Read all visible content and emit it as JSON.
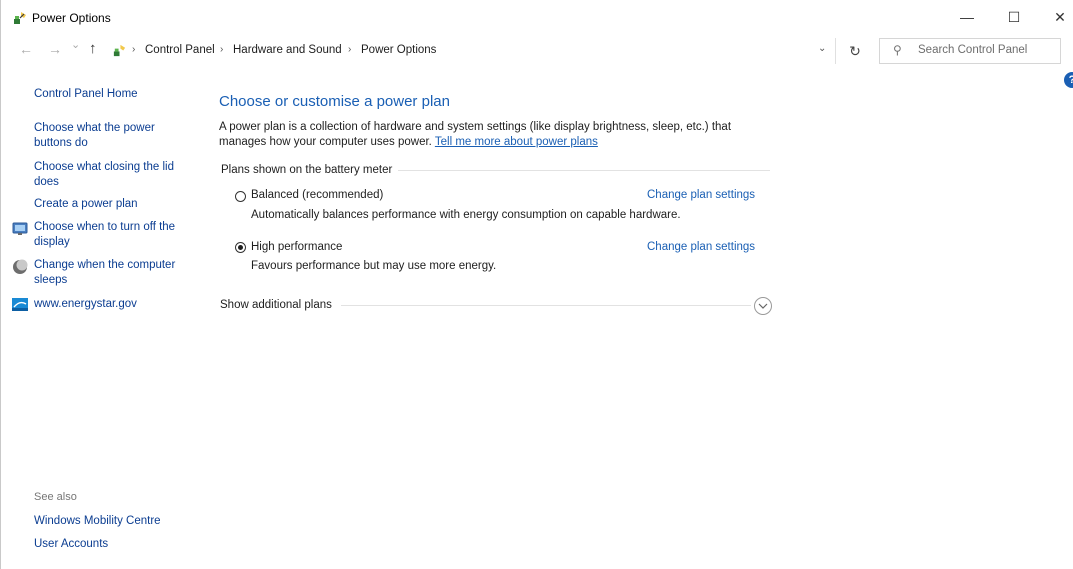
{
  "window": {
    "title": "Power Options",
    "minimize_glyph": "—",
    "maximize_glyph": "☐",
    "close_glyph": "✕"
  },
  "address": {
    "back_glyph": "←",
    "forward_glyph": "→",
    "recent_glyph": "⌄",
    "up_glyph": "↑",
    "separator": "›",
    "breadcrumb": [
      "Control Panel",
      "Hardware and Sound",
      "Power Options"
    ],
    "dropdown_glyph": "⌄",
    "refresh_glyph": "↻",
    "search_placeholder": "Search Control Panel",
    "search_icon": "⚲"
  },
  "help_icon": "?",
  "sidebar": {
    "home": "Control Panel Home",
    "links": [
      {
        "line1": "Choose what the power",
        "line2": "buttons do"
      },
      {
        "line1": "Choose what closing the lid",
        "line2": "does"
      },
      {
        "line1": "Create a power plan"
      },
      {
        "line1": "Choose when to turn off the",
        "line2": "display",
        "icon": "display-icon"
      },
      {
        "line1": "Change when the computer",
        "line2": "sleeps",
        "icon": "moon-icon"
      },
      {
        "line1": "www.energystar.gov",
        "icon": "energystar-icon"
      }
    ],
    "see_also": "See also",
    "see_also_links": [
      "Windows Mobility Centre",
      "User Accounts"
    ]
  },
  "main": {
    "title": "Choose or customise a power plan",
    "description_line1": "A power plan is a collection of hardware and system settings (like display brightness, sleep, etc.) that",
    "description_line2": "manages how your computer uses power.",
    "learn_more": "Tell me more about power plans",
    "group_label": "Plans shown on the battery meter",
    "plans": [
      {
        "name": "Balanced (recommended)",
        "description": "Automatically balances performance with energy consumption on capable hardware.",
        "change": "Change plan settings",
        "selected": false
      },
      {
        "name": "High performance",
        "description": "Favours performance but may use more energy.",
        "change": "Change plan settings",
        "selected": true
      }
    ],
    "show_additional": "Show additional plans"
  },
  "colors": {
    "accent": "#1a5fb4",
    "link": "#0b3d91"
  }
}
